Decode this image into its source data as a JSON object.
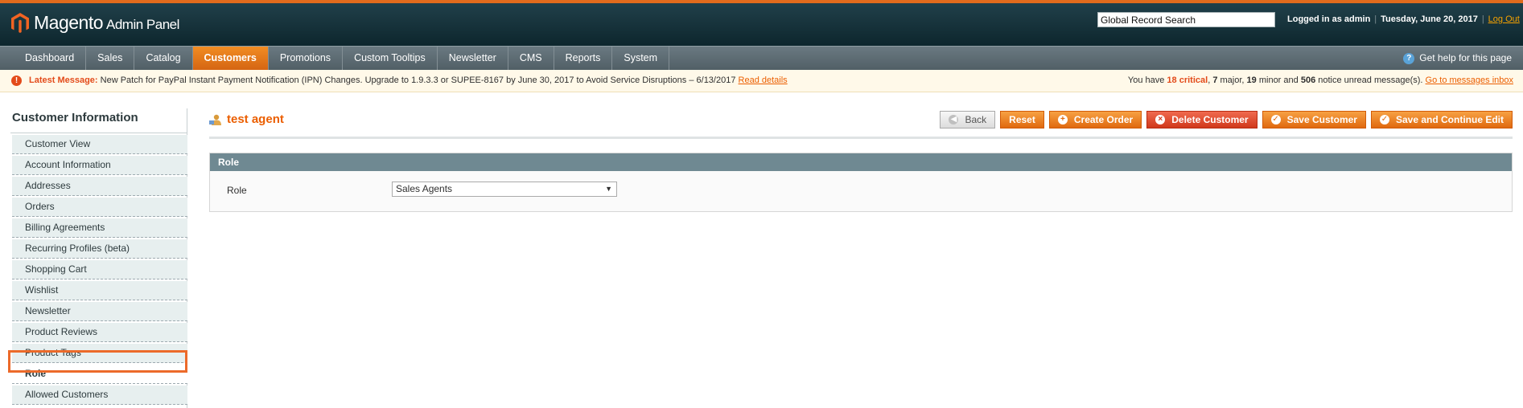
{
  "header": {
    "logo_text": "Magento",
    "logo_sub": "Admin Panel",
    "search_value": "Global Record Search",
    "logged_in": "Logged in as admin",
    "date": "Tuesday, June 20, 2017",
    "logout": "Log Out"
  },
  "nav": {
    "items": [
      "Dashboard",
      "Sales",
      "Catalog",
      "Customers",
      "Promotions",
      "Custom Tooltips",
      "Newsletter",
      "CMS",
      "Reports",
      "System"
    ],
    "active": "Customers",
    "help": "Get help for this page"
  },
  "notice": {
    "label": "Latest Message:",
    "text": "New Patch for PayPal Instant Payment Notification (IPN) Changes. Upgrade to 1.9.3.3 or SUPEE-8167 by June 30, 2017 to Avoid Service Disruptions – 6/13/2017",
    "link": "Read details",
    "summary_prefix": "You have",
    "critical": "18 critical",
    "major": "7",
    "major_label": "major,",
    "minor": "19",
    "minor_label": "minor and",
    "notice_count": "506",
    "notice_label": "notice unread message(s).",
    "inbox_link": "Go to messages inbox"
  },
  "sidebar": {
    "title": "Customer Information",
    "items": [
      "Customer View",
      "Account Information",
      "Addresses",
      "Orders",
      "Billing Agreements",
      "Recurring Profiles (beta)",
      "Shopping Cart",
      "Wishlist",
      "Newsletter",
      "Product Reviews",
      "Product Tags",
      "Role",
      "Allowed Customers"
    ],
    "active": "Role"
  },
  "page": {
    "title": "test agent",
    "buttons": {
      "back": "Back",
      "reset": "Reset",
      "create_order": "Create Order",
      "delete": "Delete Customer",
      "save": "Save Customer",
      "save_continue": "Save and Continue Edit"
    },
    "section_title": "Role",
    "field_label": "Role",
    "field_value": "Sales Agents"
  },
  "colors": {
    "accent": "#eb5e00",
    "nav_active": "#e0690f",
    "header_bg": "#1a363f",
    "highlight": "#ec6a2a"
  }
}
